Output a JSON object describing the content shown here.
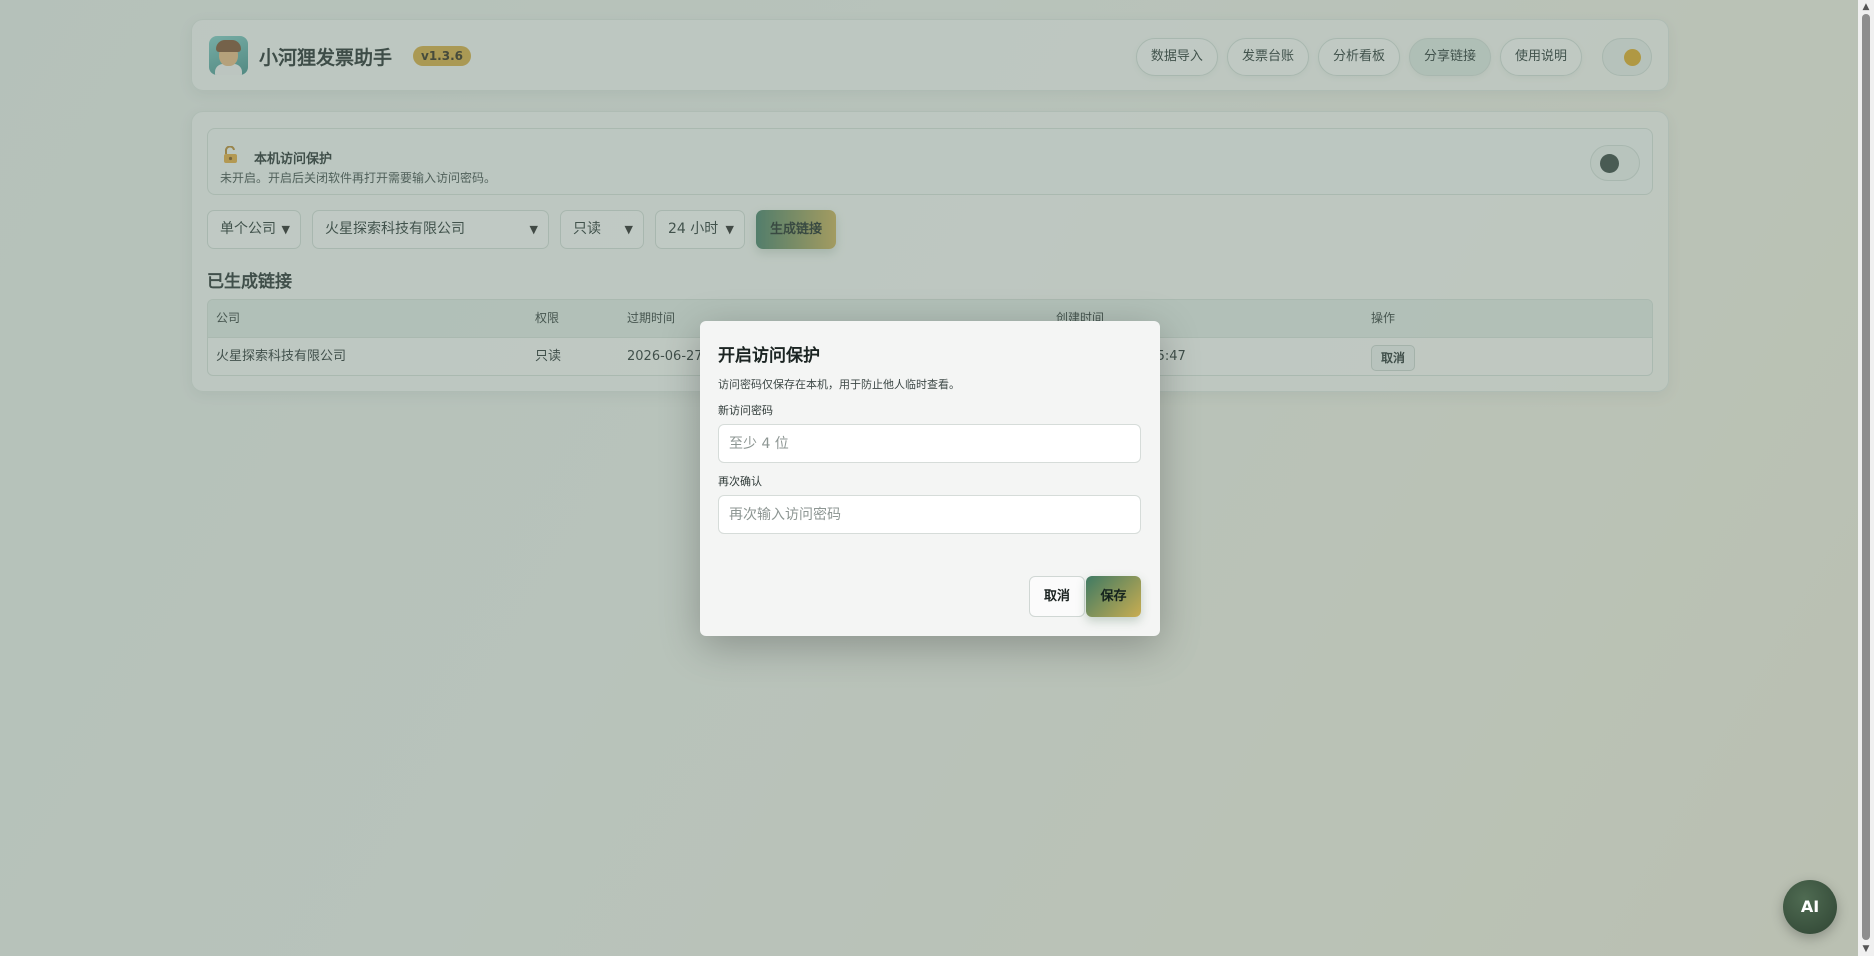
{
  "header": {
    "app_title": "小河狸发票助手",
    "version": "v1.3.6",
    "nav": [
      "数据导入",
      "发票台账",
      "分析看板",
      "分享链接",
      "使用说明"
    ],
    "active_nav": "分享链接"
  },
  "protection": {
    "title": "本机访问保护",
    "desc": "未开启。开启后关闭软件再打开需要输入访问密码。",
    "enabled": false
  },
  "controls": {
    "scope": "单个公司",
    "company": "火星探索科技有限公司",
    "permission": "只读",
    "duration": "24 小时",
    "generate_label": "生成链接"
  },
  "links": {
    "section_title": "已生成链接",
    "headers": [
      "公司",
      "权限",
      "过期时间",
      "创建时间",
      "操作"
    ],
    "rows": [
      {
        "company": "火星探索科技有限公司",
        "permission": "只读",
        "expires": "2026-06-27",
        "created": "2026-06-24 06:5:47",
        "action": "取消"
      }
    ]
  },
  "modal": {
    "title": "开启访问保护",
    "desc": "访问密码仅保存在本机，用于防止他人临时查看。",
    "new_label": "新访问密码",
    "new_placeholder": "至少 4 位",
    "new_value": "",
    "confirm_label": "再次确认",
    "confirm_placeholder": "再次输入访问密码",
    "confirm_value": "",
    "cancel_label": "取消",
    "save_label": "保存"
  },
  "ai_button": "AI",
  "colors": {
    "accent_gold": "#d6a93c",
    "accent_green": "#3f7a63",
    "overlay": "rgba(110,130,120,0.42)"
  }
}
